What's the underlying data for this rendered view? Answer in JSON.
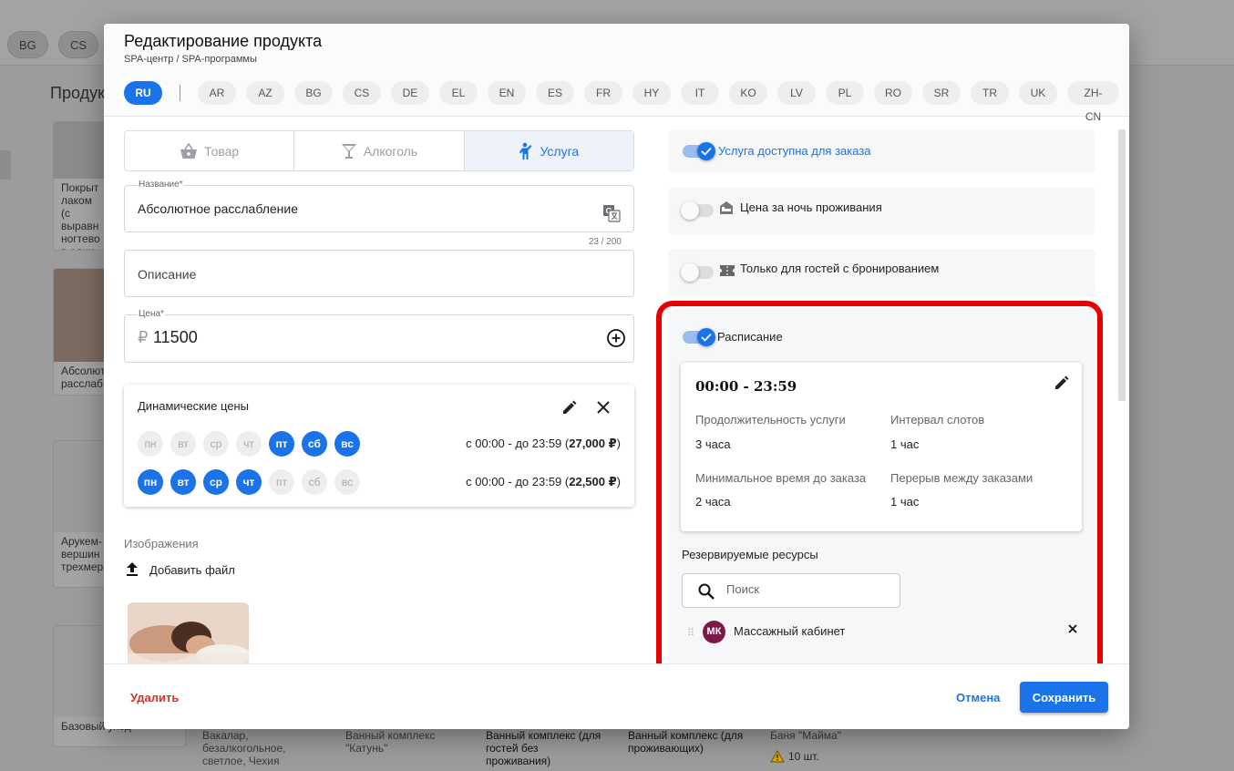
{
  "background": {
    "top_chips": [
      "BG",
      "CS"
    ],
    "page_title": "Продук",
    "cards": [
      {
        "text": "Покрыт лаком (с выравн ногтево в один т"
      },
      {
        "text": "Абсолют расслаб"
      },
      {
        "text": "Арукем- вершин трехмер"
      },
      {
        "text": "Базовый уход"
      }
    ],
    "bottom_texts": [
      "Вакалар, безалкогольное, светлое, Чехия",
      "Ванный комплекс \"Катунь\"",
      "Ванный комплекс (для гостей без проживания)",
      "Ванный комплекс (для проживающих)",
      "Баня \"Майма\"",
      "10 шт."
    ]
  },
  "modal": {
    "title": "Редактирование продукта",
    "breadcrumb": "SPA-центр / SPA-программы",
    "active_language": "RU",
    "languages": [
      "AR",
      "AZ",
      "BG",
      "CS",
      "DE",
      "EL",
      "EN",
      "ES",
      "FR",
      "HY",
      "IT",
      "KO",
      "LV",
      "PL",
      "RO",
      "SR",
      "TR",
      "UK",
      "ZH-CN"
    ],
    "type_tabs": [
      {
        "label": "Товар",
        "icon": "basket-icon",
        "active": false
      },
      {
        "label": "Алкоголь",
        "icon": "cocktail-icon",
        "active": false
      },
      {
        "label": "Услуга",
        "icon": "person-service-icon",
        "active": true
      }
    ],
    "name_field": {
      "label": "Название*",
      "value": "Абсолютное расслабление",
      "counter": "23 / 200"
    },
    "description_field": {
      "placeholder": "Описание"
    },
    "price_field": {
      "label": "Цена*",
      "currency": "₽",
      "value": "11500"
    },
    "dynamic_prices": {
      "title": "Динамические цены",
      "rules": [
        {
          "days": [
            {
              "label": "пн",
              "on": false
            },
            {
              "label": "вт",
              "on": false
            },
            {
              "label": "ср",
              "on": false
            },
            {
              "label": "чт",
              "on": false
            },
            {
              "label": "пт",
              "on": true
            },
            {
              "label": "сб",
              "on": true
            },
            {
              "label": "вс",
              "on": true
            }
          ],
          "range_prefix": "с 00:00 - до 23:59 (",
          "price": "27,000 ₽",
          "range_suffix": ")"
        },
        {
          "days": [
            {
              "label": "пн",
              "on": true
            },
            {
              "label": "вт",
              "on": true
            },
            {
              "label": "ср",
              "on": true
            },
            {
              "label": "чт",
              "on": true
            },
            {
              "label": "пт",
              "on": false
            },
            {
              "label": "сб",
              "on": false
            },
            {
              "label": "вс",
              "on": false
            }
          ],
          "range_prefix": "с 00:00 - до 23:59 (",
          "price": "22,500 ₽",
          "range_suffix": ")"
        }
      ]
    },
    "images": {
      "label": "Изображения",
      "add_file": "Добавить файл"
    },
    "options": {
      "available": {
        "label": "Услуга доступна для заказа",
        "enabled": true
      },
      "per_night": {
        "label": "Цена за ночь проживания",
        "enabled": false
      },
      "guests_only": {
        "label": "Только для гостей с бронированием",
        "enabled": false
      },
      "schedule": {
        "label": "Расписание",
        "enabled": true
      }
    },
    "schedule": {
      "time": "00:00 - 23:59",
      "duration_label": "Продолжительность услуги",
      "duration_value": "3 часа",
      "interval_label": "Интервал слотов",
      "interval_value": "1 час",
      "min_time_label": "Минимальное время до заказа",
      "min_time_value": "2 часа",
      "break_label": "Перерыв между заказами",
      "break_value": "1 час"
    },
    "resources": {
      "title": "Резервируемые ресурсы",
      "search_placeholder": "Поиск",
      "items": [
        {
          "initials": "МК",
          "name": "Массажный кабинет"
        }
      ]
    },
    "footer": {
      "delete": "Удалить",
      "cancel": "Отмена",
      "save": "Сохранить"
    },
    "colors": {
      "accent": "#1a73e8",
      "danger": "#d93025",
      "highlight": "#e60000",
      "avatar": "#7b1a4a"
    }
  }
}
